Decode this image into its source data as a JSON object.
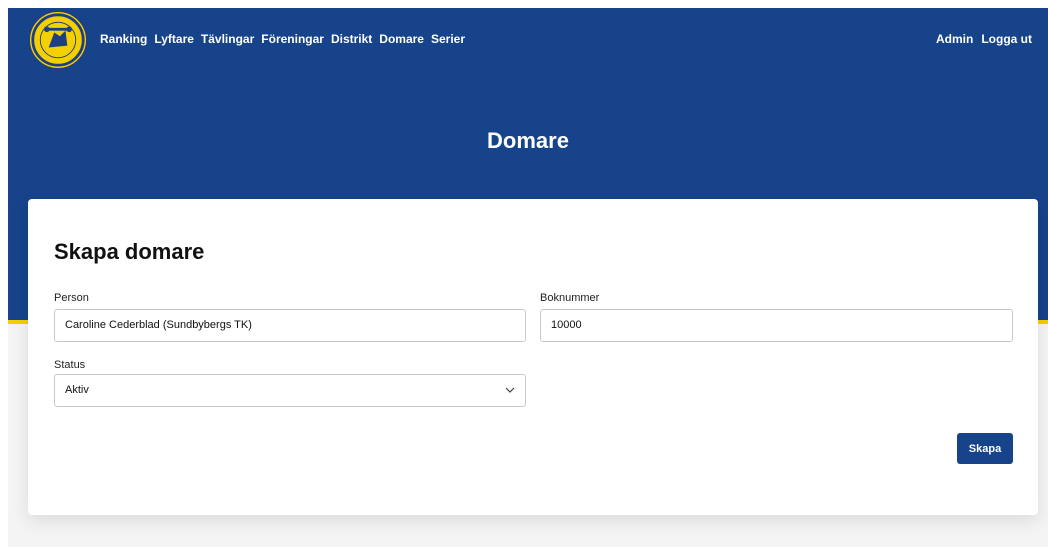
{
  "nav": {
    "items": [
      {
        "label": "Ranking"
      },
      {
        "label": "Lyftare"
      },
      {
        "label": "Tävlingar"
      },
      {
        "label": "Föreningar"
      },
      {
        "label": "Distrikt"
      },
      {
        "label": "Domare"
      },
      {
        "label": "Serier"
      }
    ],
    "right": {
      "admin_label": "Admin",
      "logout_label": "Logga ut"
    }
  },
  "logo": {
    "icon": "federation-logo-icon"
  },
  "page": {
    "title": "Domare"
  },
  "form": {
    "heading": "Skapa domare",
    "person": {
      "label": "Person",
      "value": "Caroline Cederblad (Sundbybergs TK)"
    },
    "boknummer": {
      "label": "Boknummer",
      "value": "10000"
    },
    "status": {
      "label": "Status",
      "selected": "Aktiv"
    },
    "submit_label": "Skapa"
  },
  "colors": {
    "primary": "#16438a",
    "accent": "#f5d000",
    "background": "#f4f4f4"
  }
}
